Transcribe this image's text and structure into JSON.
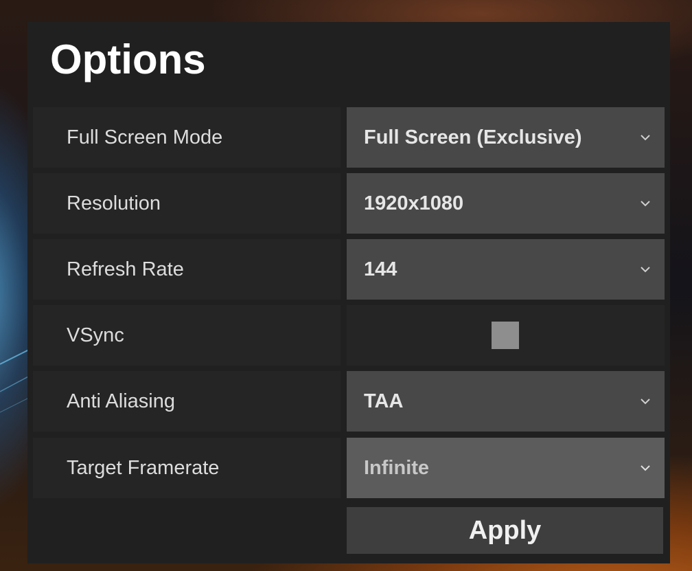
{
  "options": {
    "title": "Options",
    "rows": [
      {
        "label": "Full Screen Mode",
        "value": "Full Screen (Exclusive)"
      },
      {
        "label": "Resolution",
        "value": "1920x1080"
      },
      {
        "label": "Refresh Rate",
        "value": "144"
      },
      {
        "label": "VSync",
        "checked": false
      },
      {
        "label": "Anti Aliasing",
        "value": "TAA"
      },
      {
        "label": "Target Framerate",
        "value": "Infinite"
      }
    ],
    "apply_label": "Apply"
  },
  "icons": {
    "dropdown": "chevron-down-icon"
  },
  "colors": {
    "panel": "#202020",
    "label_bg": "#252525",
    "dropdown_bg": "#484848",
    "dropdown_highlight_bg": "#5c5c5c",
    "checkbox": "#8e8e8e",
    "apply_bg": "#3e3e3e"
  }
}
